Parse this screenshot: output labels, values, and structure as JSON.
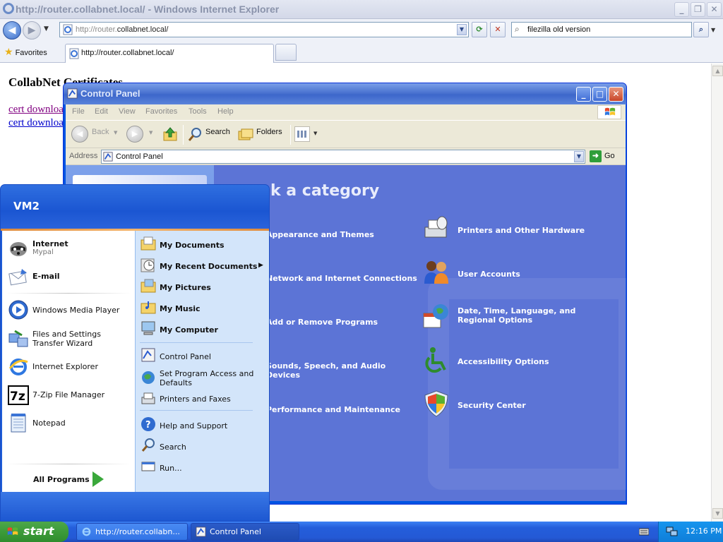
{
  "ie": {
    "window_title": "http://router.collabnet.local/ - Windows Internet Explorer",
    "address_prefix": "http://router.",
    "address_host": "collabnet.local/",
    "search_text": "filezilla old version",
    "favorites_label": "Favorites",
    "tab_label": "http://router.collabnet.local/",
    "page": {
      "heading": "CollabNet Certificates",
      "links": [
        "cert downloa",
        "cert downloa"
      ],
      "link_colors": [
        "#800080",
        "#0000cc"
      ]
    }
  },
  "control_panel": {
    "title": "Control Panel",
    "menu": [
      "File",
      "Edit",
      "View",
      "Favorites",
      "Tools",
      "Help"
    ],
    "toolbar": {
      "back": "Back",
      "search": "Search",
      "folders": "Folders"
    },
    "address_label": "Address",
    "address_value": "Control Panel",
    "go_label": "Go",
    "heading": "k a category",
    "categories_left": [
      "Appearance and Themes",
      "Network and Internet Connections",
      "Add or Remove Programs",
      "Sounds, Speech, and Audio Devices",
      "Performance and Maintenance"
    ],
    "categories_right": [
      {
        "label": "Printers and Other Hardware",
        "icon": "printer-icon"
      },
      {
        "label": "User Accounts",
        "icon": "users-icon"
      },
      {
        "label": "Date, Time, Language, and Regional Options",
        "icon": "calendar-globe-icon"
      },
      {
        "label": "Accessibility Options",
        "icon": "accessibility-icon"
      },
      {
        "label": "Security Center",
        "icon": "shield-icon"
      }
    ]
  },
  "start_menu": {
    "user": "VM2",
    "pinned": [
      {
        "label": "Internet",
        "sub": "Mypal"
      },
      {
        "label": "E-mail",
        "sub": ""
      }
    ],
    "recent": [
      "Windows Media Player",
      "Files and Settings Transfer Wizard",
      "Internet Explorer",
      "7-Zip File Manager",
      "Notepad"
    ],
    "all_programs": "All Programs",
    "right_top": [
      "My Documents",
      "My Recent Documents",
      "My Pictures",
      "My Music",
      "My Computer"
    ],
    "right_mid": [
      "Control Panel",
      "Set Program Access and Defaults",
      "Printers and Faxes"
    ],
    "right_bottom": [
      "Help and Support",
      "Search",
      "Run..."
    ]
  },
  "taskbar": {
    "start_label": "start",
    "tasks": [
      "http://router.collabn...",
      "Control Panel"
    ],
    "clock": "12:16 PM"
  },
  "colors": {
    "xp_blue": "#0054e3",
    "cp_main_bg": "#5c74d6",
    "start_green": "#3c9b39"
  }
}
